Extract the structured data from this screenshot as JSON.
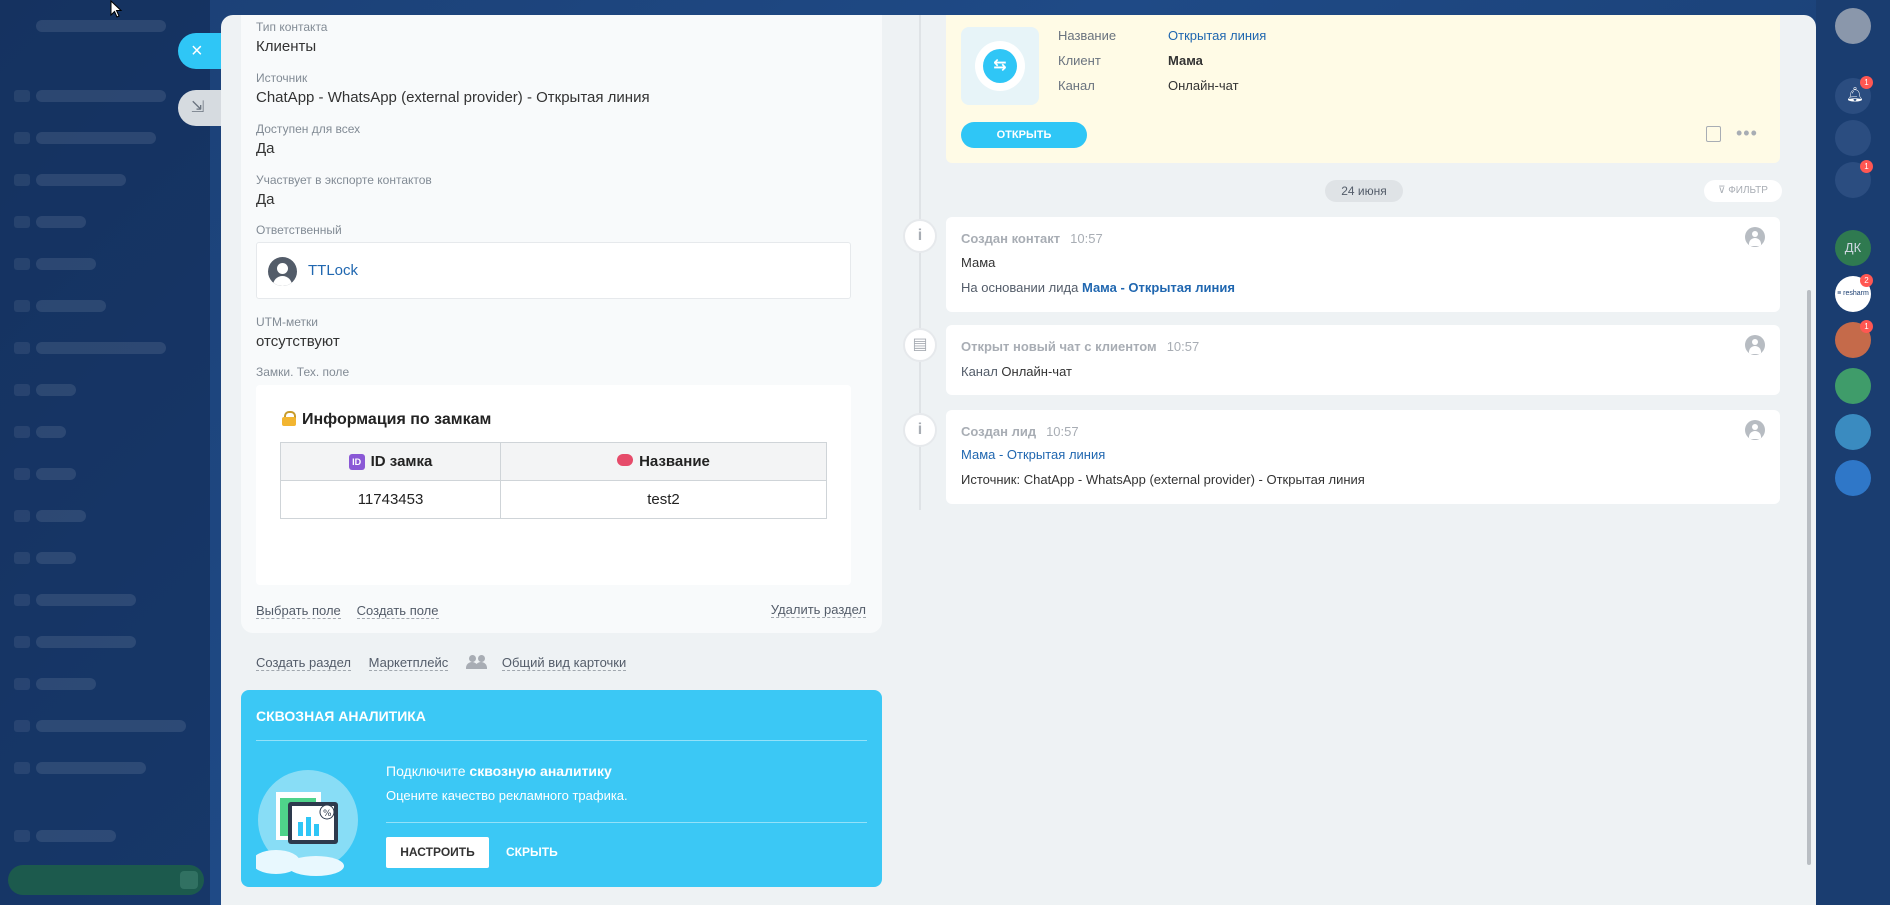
{
  "close_label": "×",
  "minimize_label": "⇲",
  "fields": [
    {
      "label": "Тип контакта",
      "value": "Клиенты"
    },
    {
      "label": "Источник",
      "value": "ChatApp - WhatsApp (external provider) - Открытая линия"
    },
    {
      "label": "Доступен для всех",
      "value": "Да"
    },
    {
      "label": "Участвует в экспорте контактов",
      "value": "Да"
    }
  ],
  "responsible": {
    "label": "Ответственный",
    "name": "TTLock"
  },
  "utm": {
    "label": "UTM-метки",
    "value": "отсутствуют"
  },
  "locks": {
    "label": "Замки. Тех. поле",
    "title": "Информация по замкам",
    "col_id": "ID замка",
    "col_name": "Название",
    "rows": [
      {
        "id": "11743453",
        "name": "test2"
      }
    ]
  },
  "card_links": {
    "select_field": "Выбрать поле",
    "create_field": "Создать поле",
    "delete_section": "Удалить раздел"
  },
  "below_links": {
    "create_section": "Создать раздел",
    "marketplace": "Маркетплейс",
    "common_view": "Общий вид карточки"
  },
  "analytics": {
    "title": "СКВОЗНАЯ АНАЛИТИКА",
    "line1_prefix": "Подключите ",
    "line1_bold": "сквозную аналитику",
    "line2": "Оцените качество рекламного трафика.",
    "setup": "НАСТРОИТЬ",
    "hide": "СКРЫТЬ"
  },
  "top_card": {
    "name_k": "Название",
    "name_v": "Открытая линия",
    "client_k": "Клиент",
    "client_v": "Мама",
    "channel_k": "Канал",
    "channel_v": "Онлайн-чат",
    "open": "ОТКРЫТЬ"
  },
  "date_pill": "24 июня",
  "filter": "ФИЛЬТР",
  "events": [
    {
      "title": "Создан контакт",
      "time": "10:57",
      "line1": "Мама",
      "line2_k": "На основании лида ",
      "line2_link": "Мама - Открытая линия"
    },
    {
      "title": "Открыт новый чат с клиентом",
      "time": "10:57",
      "line1_k": "Канал ",
      "line1_v": "Онлайн-чат"
    },
    {
      "title": "Создан лид",
      "time": "10:57",
      "line1_link": "Мама - Открытая линия",
      "line2": "Источник: ChatApp - WhatsApp (external provider) - Открытая линия"
    }
  ],
  "rightbar": {
    "badges": [
      "1",
      "1",
      "2",
      "1"
    ],
    "avatar_initials": "ДК",
    "logo_text": "≡ resharm"
  },
  "colors": {
    "accent": "#2fc6f6",
    "link": "#2067b0",
    "analytics_bg": "#3bc8f5",
    "top_card_bg": "#fffbe6",
    "badge": "#ff5752"
  }
}
